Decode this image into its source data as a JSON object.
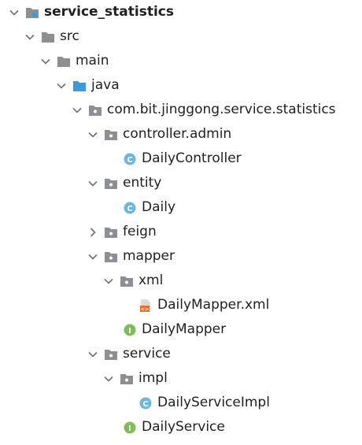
{
  "colors": {
    "folder": "#8c8f94",
    "source_folder": "#3b9ad9",
    "class_badge": "#6bb7e0",
    "interface_badge": "#7cbf57",
    "xml_icon": "#e86b34",
    "arrow": "#6f6f6f"
  },
  "tree": {
    "root": {
      "label": "service_statistics",
      "icon": "module-folder-icon",
      "expanded": true
    },
    "src": {
      "label": "src",
      "icon": "folder-icon",
      "expanded": true
    },
    "main": {
      "label": "main",
      "icon": "folder-icon",
      "expanded": true
    },
    "java": {
      "label": "java",
      "icon": "source-root-folder-icon",
      "expanded": true
    },
    "pkg": {
      "label": "com.bit.jinggong.service.statistics",
      "icon": "package-icon",
      "expanded": true
    },
    "controller_admin": {
      "label": "controller.admin",
      "icon": "package-icon",
      "expanded": true
    },
    "daily_controller": {
      "label": "DailyController",
      "icon": "class-icon",
      "badge": "C"
    },
    "entity": {
      "label": "entity",
      "icon": "package-icon",
      "expanded": true
    },
    "daily": {
      "label": "Daily",
      "icon": "class-icon",
      "badge": "C"
    },
    "feign": {
      "label": "feign",
      "icon": "package-icon",
      "expanded": false
    },
    "mapper": {
      "label": "mapper",
      "icon": "package-icon",
      "expanded": true
    },
    "xml": {
      "label": "xml",
      "icon": "package-icon",
      "expanded": true
    },
    "daily_mapper_xml": {
      "label": "DailyMapper.xml",
      "icon": "xml-file-icon",
      "badge": "<>"
    },
    "daily_mapper": {
      "label": "DailyMapper",
      "icon": "interface-icon",
      "badge": "I"
    },
    "service": {
      "label": "service",
      "icon": "package-icon",
      "expanded": true
    },
    "impl": {
      "label": "impl",
      "icon": "package-icon",
      "expanded": true
    },
    "daily_service_impl": {
      "label": "DailyServiceImpl",
      "icon": "class-icon",
      "badge": "C"
    },
    "daily_service": {
      "label": "DailyService",
      "icon": "interface-icon",
      "badge": "I"
    }
  }
}
